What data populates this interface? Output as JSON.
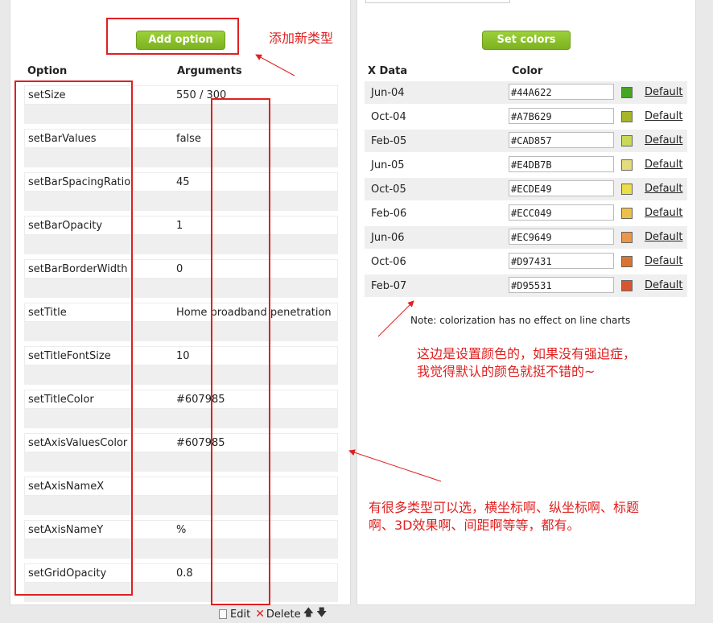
{
  "left": {
    "add_button": "Add option",
    "headers": {
      "option": "Option",
      "arguments": "Arguments"
    },
    "options": [
      {
        "name": "setSize",
        "args": "550 / 300"
      },
      {
        "name": "setBarValues",
        "args": "false"
      },
      {
        "name": "setBarSpacingRatio",
        "args": "45"
      },
      {
        "name": "setBarOpacity",
        "args": "1"
      },
      {
        "name": "setBarBorderWidth",
        "args": "0"
      },
      {
        "name": "setTitle",
        "args": "Home broadband penetration"
      },
      {
        "name": "setTitleFontSize",
        "args": "10"
      },
      {
        "name": "setTitleColor",
        "args": "#607985"
      },
      {
        "name": "setAxisValuesColor",
        "args": "#607985"
      },
      {
        "name": "setAxisNameX",
        "args": ""
      },
      {
        "name": "setAxisNameY",
        "args": "%"
      },
      {
        "name": "setGridOpacity",
        "args": "0.8"
      }
    ],
    "actions": {
      "edit": "Edit",
      "delete": "Delete",
      "up": "🡅",
      "down": "🡇"
    }
  },
  "right": {
    "set_colors_button": "Set colors",
    "headers": {
      "xdata": "X Data",
      "color": "Color"
    },
    "default_label": "Default",
    "rows": [
      {
        "x": "Jun-04",
        "color": "#44A622"
      },
      {
        "x": "Oct-04",
        "color": "#A7B629"
      },
      {
        "x": "Feb-05",
        "color": "#CAD857"
      },
      {
        "x": "Jun-05",
        "color": "#E4DB7B"
      },
      {
        "x": "Oct-05",
        "color": "#ECDE49"
      },
      {
        "x": "Feb-06",
        "color": "#ECC049"
      },
      {
        "x": "Jun-06",
        "color": "#EC9649"
      },
      {
        "x": "Oct-06",
        "color": "#D97431"
      },
      {
        "x": "Feb-07",
        "color": "#D95531"
      }
    ],
    "note": "Note: colorization has no effect on line charts"
  },
  "annotations": {
    "add_type": "添加新类型",
    "colors_line1": "这边是设置颜色的，如果没有强迫症，",
    "colors_line2": "我觉得默认的颜色就挺不错的~",
    "types_line1": "有很多类型可以选，横坐标啊、纵坐标啊、标题",
    "types_line2": "啊、3D效果啊、间距啊等等，都有。"
  },
  "colors": {
    "annotation_red": "#e02020",
    "button_green": "#8cc22b"
  }
}
